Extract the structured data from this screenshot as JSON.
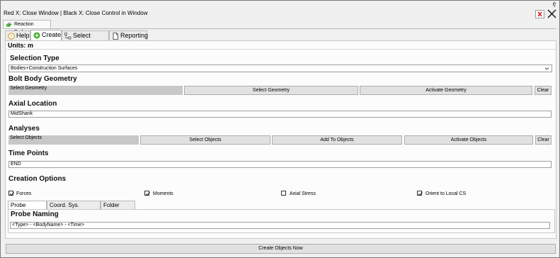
{
  "window": {
    "hint_text": "Red X: Close Window | Black X: Close Control in Window",
    "pin_glyph": "ȩ",
    "doc_tab_label": "Reaction Probes"
  },
  "tabs": [
    {
      "label": "Help",
      "icon": "help-icon"
    },
    {
      "label": "Create",
      "icon": "create-icon"
    },
    {
      "label": "Select Objects",
      "icon": "select-objects-icon"
    },
    {
      "label": "Reporting",
      "icon": "document-icon"
    }
  ],
  "units_label": "Units: m",
  "selection_type": {
    "heading": "Selection Type",
    "value": "Bodies+Construction Surfaces"
  },
  "bolt_body": {
    "heading": "Bolt Body Geometry",
    "field_text": "Select Geometry",
    "select_button": "Select Geometry",
    "activate_button": "Activate Geometry",
    "clear_button": "Clear"
  },
  "axial_location": {
    "heading": "Axial Location",
    "value": "MidShank"
  },
  "analyses": {
    "heading": "Analyses",
    "field_text": "Select Objects",
    "select_button": "Select Objects",
    "add_button": "Add To Objects",
    "activate_button": "Activate Objects",
    "clear_button": "Clear"
  },
  "time_points": {
    "heading": "Time Points",
    "value": "END"
  },
  "creation_options": {
    "heading": "Creation Options",
    "checkboxes": [
      {
        "label": "Forces",
        "checked": true
      },
      {
        "label": "Moments",
        "checked": true
      },
      {
        "label": "Axial Stress",
        "checked": false
      },
      {
        "label": "Orient to Local CS",
        "checked": true
      }
    ]
  },
  "sub_tabs": [
    "Probe Naming",
    "Coord. Sys. Naming",
    "Folder Name"
  ],
  "probe_naming": {
    "heading": "Probe Naming",
    "value": "<Type> - <BodyName> - <Time>"
  },
  "create_button": "Create Objects Now",
  "colors": {
    "accent_green": "#3fae2a",
    "close_red": "#d32020"
  }
}
